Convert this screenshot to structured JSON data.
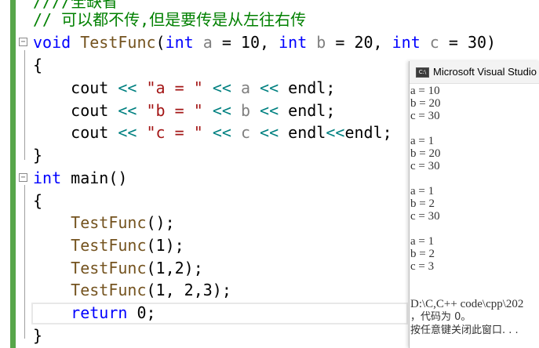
{
  "editor": {
    "lines": [
      {
        "segments": [
          {
            "t": "////全缺省",
            "c": "cm"
          }
        ]
      },
      {
        "segments": [
          {
            "t": "// 可以都不传,但是要传是从左往右传",
            "c": "cm"
          }
        ]
      },
      {
        "segments": [
          {
            "t": "void",
            "c": "kw"
          },
          {
            "t": " "
          },
          {
            "t": "TestFunc",
            "c": "fn"
          },
          {
            "t": "("
          },
          {
            "t": "int",
            "c": "kw"
          },
          {
            "t": " "
          },
          {
            "t": "a",
            "c": "param"
          },
          {
            "t": " = 10, "
          },
          {
            "t": "int",
            "c": "kw"
          },
          {
            "t": " "
          },
          {
            "t": "b",
            "c": "param"
          },
          {
            "t": " = 20, "
          },
          {
            "t": "int",
            "c": "kw"
          },
          {
            "t": " "
          },
          {
            "t": "c",
            "c": "param"
          },
          {
            "t": " = 30)"
          }
        ]
      },
      {
        "segments": [
          {
            "t": "{"
          }
        ]
      },
      {
        "segments": [
          {
            "t": "    cout "
          },
          {
            "t": "<<",
            "c": "op"
          },
          {
            "t": " "
          },
          {
            "t": "\"a = \"",
            "c": "str"
          },
          {
            "t": " "
          },
          {
            "t": "<<",
            "c": "op"
          },
          {
            "t": " "
          },
          {
            "t": "a",
            "c": "param"
          },
          {
            "t": " "
          },
          {
            "t": "<<",
            "c": "op"
          },
          {
            "t": " endl;"
          }
        ]
      },
      {
        "segments": [
          {
            "t": "    cout "
          },
          {
            "t": "<<",
            "c": "op"
          },
          {
            "t": " "
          },
          {
            "t": "\"b = \"",
            "c": "str"
          },
          {
            "t": " "
          },
          {
            "t": "<<",
            "c": "op"
          },
          {
            "t": " "
          },
          {
            "t": "b",
            "c": "param"
          },
          {
            "t": " "
          },
          {
            "t": "<<",
            "c": "op"
          },
          {
            "t": " endl;"
          }
        ]
      },
      {
        "segments": [
          {
            "t": "    cout "
          },
          {
            "t": "<<",
            "c": "op"
          },
          {
            "t": " "
          },
          {
            "t": "\"c = \"",
            "c": "str"
          },
          {
            "t": " "
          },
          {
            "t": "<<",
            "c": "op"
          },
          {
            "t": " "
          },
          {
            "t": "c",
            "c": "param"
          },
          {
            "t": " "
          },
          {
            "t": "<<",
            "c": "op"
          },
          {
            "t": " endl"
          },
          {
            "t": "<<",
            "c": "op"
          },
          {
            "t": "endl;"
          }
        ]
      },
      {
        "segments": [
          {
            "t": "}"
          }
        ]
      },
      {
        "segments": [
          {
            "t": "int",
            "c": "kw"
          },
          {
            "t": " main()"
          }
        ]
      },
      {
        "segments": [
          {
            "t": "{"
          }
        ]
      },
      {
        "segments": [
          {
            "t": "    "
          },
          {
            "t": "TestFunc",
            "c": "fn"
          },
          {
            "t": "();"
          }
        ]
      },
      {
        "segments": [
          {
            "t": "    "
          },
          {
            "t": "TestFunc",
            "c": "fn"
          },
          {
            "t": "(1);"
          }
        ]
      },
      {
        "segments": [
          {
            "t": "    "
          },
          {
            "t": "TestFunc",
            "c": "fn"
          },
          {
            "t": "(1,2);"
          }
        ]
      },
      {
        "segments": [
          {
            "t": "    "
          },
          {
            "t": "TestFunc",
            "c": "fn"
          },
          {
            "t": "(1, 2,3);"
          }
        ]
      },
      {
        "segments": [
          {
            "t": "    "
          },
          {
            "t": "return",
            "c": "kw"
          },
          {
            "t": " 0;"
          }
        ]
      },
      {
        "segments": [
          {
            "t": "}"
          }
        ]
      }
    ],
    "fold_button": "−"
  },
  "console": {
    "icon_text": "C:\\",
    "title": "Microsoft Visual Studio",
    "lines": [
      "a = 10",
      "b = 20",
      "c = 30",
      "",
      "a = 1",
      "b = 20",
      "c = 30",
      "",
      "a = 1",
      "b = 2",
      "c = 30",
      "",
      "a = 1",
      "b = 2",
      "c = 3",
      "",
      "",
      "D:\\C,C++ code\\cpp\\202",
      "，代码为 0。",
      "按任意键关闭此窗口. . ."
    ]
  },
  "colors": {
    "keyword": "#0000ff",
    "comment": "#008000",
    "string": "#a31515",
    "function": "#74531f",
    "parameter": "#808080",
    "operator": "#008080",
    "change_margin": "#57a64a"
  }
}
